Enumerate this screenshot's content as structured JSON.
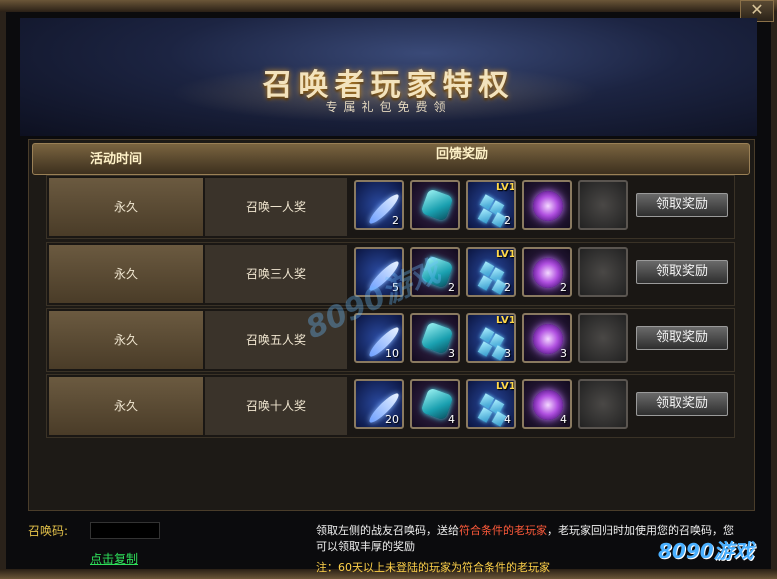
{
  "window": {
    "close_icon": "close-icon"
  },
  "banner": {
    "title": "召唤者玩家特权",
    "subtitle": "专属礼包免费领"
  },
  "table": {
    "header_time": "活动时间",
    "header_reward": "回馈奖励",
    "rows": [
      {
        "time": "永久",
        "name": "召唤一人奖",
        "items": [
          {
            "icon": "feather-icon",
            "count": "2"
          },
          {
            "icon": "crystal-icon",
            "count": ""
          },
          {
            "icon": "crystal-shards-icon",
            "level": "LV1",
            "count": "2"
          },
          {
            "icon": "purple-orb-icon",
            "count": ""
          },
          {
            "icon": "empty-slot",
            "count": ""
          }
        ],
        "button": "领取奖励"
      },
      {
        "time": "永久",
        "name": "召唤三人奖",
        "items": [
          {
            "icon": "feather-icon",
            "count": "5"
          },
          {
            "icon": "crystal-icon",
            "count": "2"
          },
          {
            "icon": "crystal-shards-icon",
            "level": "LV1",
            "count": "2"
          },
          {
            "icon": "purple-orb-icon",
            "count": "2"
          },
          {
            "icon": "empty-slot",
            "count": ""
          }
        ],
        "button": "领取奖励"
      },
      {
        "time": "永久",
        "name": "召唤五人奖",
        "items": [
          {
            "icon": "feather-icon",
            "count": "10"
          },
          {
            "icon": "crystal-icon",
            "count": "3"
          },
          {
            "icon": "crystal-shards-icon",
            "level": "LV1",
            "count": "3"
          },
          {
            "icon": "purple-orb-icon",
            "count": "3"
          },
          {
            "icon": "empty-slot",
            "count": ""
          }
        ],
        "button": "领取奖励"
      },
      {
        "time": "永久",
        "name": "召唤十人奖",
        "items": [
          {
            "icon": "feather-icon",
            "count": "20"
          },
          {
            "icon": "crystal-icon",
            "count": "4"
          },
          {
            "icon": "crystal-shards-icon",
            "level": "LV1",
            "count": "4"
          },
          {
            "icon": "purple-orb-icon",
            "count": "4"
          },
          {
            "icon": "empty-slot",
            "count": ""
          }
        ],
        "button": "领取奖励"
      }
    ]
  },
  "footer": {
    "code_label": "召唤码:",
    "copy_link": "点击复制",
    "info_part1": "领取左侧的战友召唤码，送给",
    "info_highlight": "符合条件的老玩家",
    "info_part2": "，老玩家回归时加使用您的召唤码，您可以领取丰厚的奖励",
    "note": "注：60天以上未登陆的玩家为符合条件的老玩家"
  },
  "watermark": {
    "text": "8090游戏"
  },
  "logo": {
    "text": "8090游戏"
  },
  "colors": {
    "gold": "#f3e3bd",
    "highlight_red": "#ff5a3a",
    "note_yellow": "#ffd24a",
    "link_green": "#2ee05a"
  }
}
